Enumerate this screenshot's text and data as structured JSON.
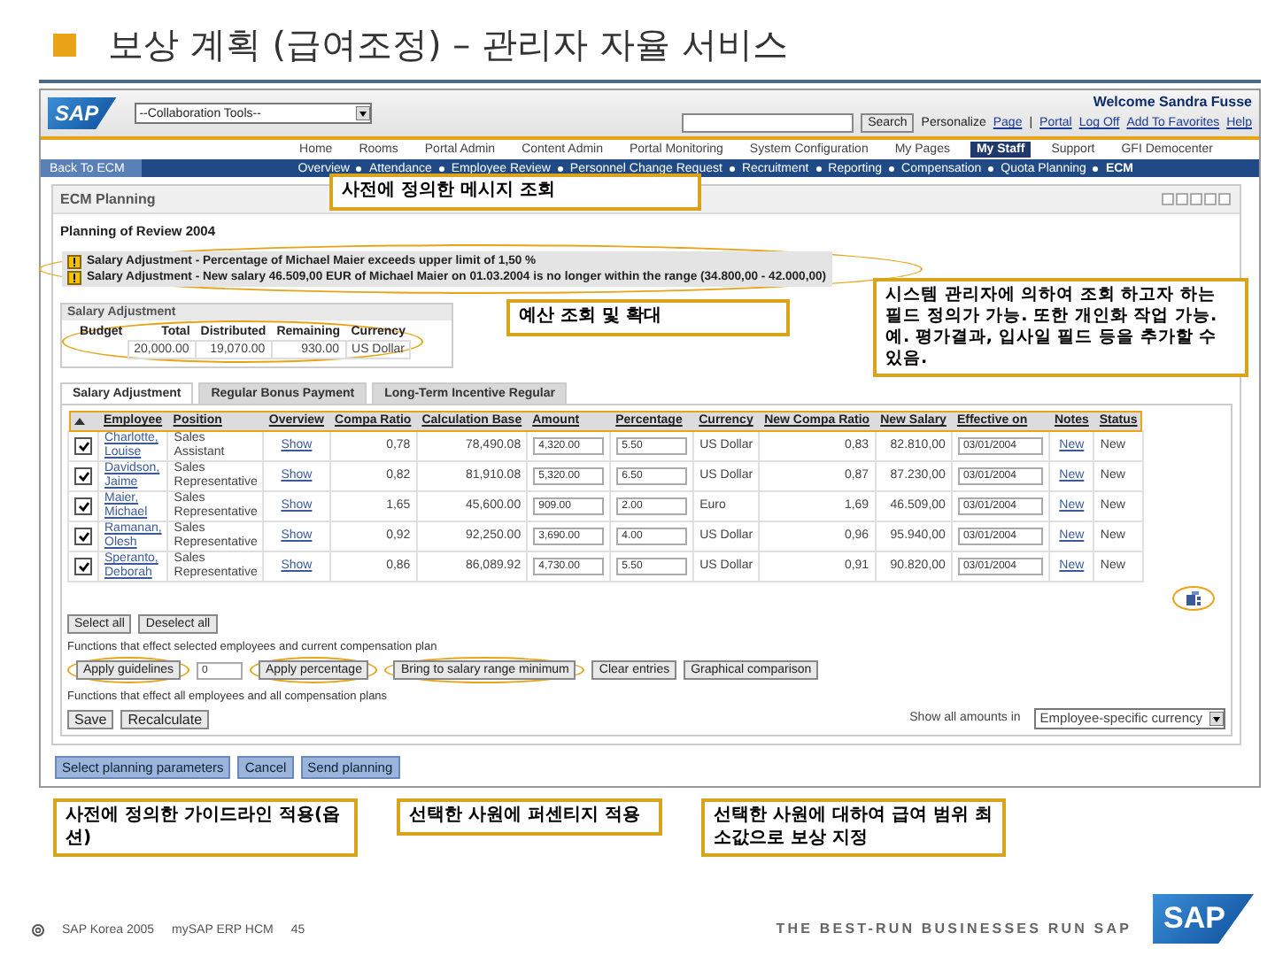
{
  "slide": {
    "title": "보상 계획 (급여조정) – 관리자 자율 서비스"
  },
  "portal": {
    "logo": "SAP",
    "tools_dropdown": "--Collaboration Tools--",
    "welcome": "Welcome Sandra Fusse",
    "search_button": "Search",
    "header_links": [
      {
        "label": "Personalize",
        "kind": "text"
      },
      {
        "label": "Page",
        "kind": "link"
      },
      {
        "label": "|",
        "kind": "text"
      },
      {
        "label": "Portal",
        "kind": "link"
      },
      {
        "label": "Log Off",
        "kind": "link"
      },
      {
        "label": "Add To Favorites",
        "kind": "link"
      },
      {
        "label": "Help",
        "kind": "link"
      }
    ],
    "top_nav": [
      {
        "label": "Home",
        "selected": false
      },
      {
        "label": "Rooms",
        "selected": false
      },
      {
        "label": "Portal Admin",
        "selected": false
      },
      {
        "label": "Content Admin",
        "selected": false
      },
      {
        "label": "Portal Monitoring",
        "selected": false
      },
      {
        "label": "System Configuration",
        "selected": false
      },
      {
        "label": "My Pages",
        "selected": false
      },
      {
        "label": "My Staff",
        "selected": true
      },
      {
        "label": "Support",
        "selected": false
      },
      {
        "label": "GFI Democenter",
        "selected": false
      }
    ],
    "back_button": "Back To ECM",
    "sub_nav": [
      {
        "label": "Overview",
        "selected": false
      },
      {
        "label": "Attendance",
        "selected": false
      },
      {
        "label": "Employee Review",
        "selected": false
      },
      {
        "label": "Personnel Change Request",
        "selected": false
      },
      {
        "label": "Recruitment",
        "selected": false
      },
      {
        "label": "Reporting",
        "selected": false
      },
      {
        "label": "Compensation",
        "selected": false
      },
      {
        "label": "Quota Planning",
        "selected": false
      },
      {
        "label": "ECM",
        "selected": true
      }
    ]
  },
  "panel": {
    "title": "ECM Planning",
    "subtitle": "Planning of Review 2004",
    "messages_circled": true,
    "messages": [
      {
        "kind": "warning",
        "text": "Salary Adjustment - Percentage of Michael Maier exceeds upper limit of 1,50 %"
      },
      {
        "kind": "warning",
        "text": "Salary Adjustment - New salary 46.509,00 EUR of Michael Maier on 01.03.2004 is no longer within the range (34.800,00 - 42.000,00)"
      }
    ],
    "budget": {
      "title": "Salary Adjustment",
      "circled": true,
      "columns": [
        "Budget",
        "Total",
        "Distributed",
        "Remaining",
        "Currency"
      ],
      "values": [
        "20,000.00",
        "19,070.00",
        "930.00",
        "US Dollar"
      ]
    },
    "tabs": [
      {
        "label": "Salary Adjustment",
        "selected": true
      },
      {
        "label": "Regular Bonus Payment",
        "selected": false
      },
      {
        "label": "Long-Term Incentive Regular",
        "selected": false
      }
    ],
    "table": {
      "header_circled": true,
      "columns": [
        "Employee",
        "Position",
        "Overview",
        "Compa Ratio",
        "Calculation Base",
        "Amount",
        "Percentage",
        "Currency",
        "New Compa Ratio",
        "New Salary",
        "Effective on",
        "Notes",
        "Status"
      ],
      "rows": [
        {
          "checked": true,
          "employee": "Charlotte, Louise",
          "position": "Sales Assistant",
          "overview": "Show",
          "compa_ratio": "0,78",
          "calculation_base": "78,490.08",
          "amount": "4,320.00",
          "percentage": "5.50",
          "currency": "US Dollar",
          "new_compa_ratio": "0,83",
          "new_salary": "82.810,00",
          "effective_on": "03/01/2004",
          "notes": "New",
          "status": "New"
        },
        {
          "checked": true,
          "employee": "Davidson, Jaime",
          "position": "Sales Representative",
          "overview": "Show",
          "compa_ratio": "0,82",
          "calculation_base": "81,910.08",
          "amount": "5,320.00",
          "percentage": "6.50",
          "currency": "US Dollar",
          "new_compa_ratio": "0,87",
          "new_salary": "87.230,00",
          "effective_on": "03/01/2004",
          "notes": "New",
          "status": "New"
        },
        {
          "checked": true,
          "employee": "Maier, Michael",
          "position": "Sales Representative",
          "overview": "Show",
          "compa_ratio": "1,65",
          "calculation_base": "45,600.00",
          "amount": "909.00",
          "percentage": "2.00",
          "currency": "Euro",
          "new_compa_ratio": "1,69",
          "new_salary": "46.509,00",
          "effective_on": "03/01/2004",
          "notes": "New",
          "status": "New"
        },
        {
          "checked": true,
          "employee": "Ramanan, Olesh",
          "position": "Sales Representative",
          "overview": "Show",
          "compa_ratio": "0,92",
          "calculation_base": "92,250.00",
          "amount": "3,690.00",
          "percentage": "4.00",
          "currency": "US Dollar",
          "new_compa_ratio": "0,96",
          "new_salary": "95.940,00",
          "effective_on": "03/01/2004",
          "notes": "New",
          "status": "New"
        },
        {
          "checked": true,
          "employee": "Speranto, Deborah",
          "position": "Sales Representative",
          "overview": "Show",
          "compa_ratio": "0,86",
          "calculation_base": "86,089.92",
          "amount": "4,730.00",
          "percentage": "5.50",
          "currency": "US Dollar",
          "new_compa_ratio": "0,91",
          "new_salary": "90.820,00",
          "effective_on": "03/01/2004",
          "notes": "New",
          "status": "New"
        }
      ]
    },
    "settings_circled": true,
    "selection_buttons": [
      "Select all",
      "Deselect all"
    ],
    "selected_functions": {
      "label": "Functions that effect selected employees and current compensation plan",
      "controls": [
        {
          "kind": "button",
          "label": "Apply guidelines",
          "circled": true
        },
        {
          "kind": "input",
          "value": "0"
        },
        {
          "kind": "button",
          "label": "Apply percentage",
          "circled": true
        },
        {
          "kind": "button",
          "label": "Bring to salary range minimum",
          "circled": true
        },
        {
          "kind": "button",
          "label": "Clear entries",
          "circled": false
        },
        {
          "kind": "button",
          "label": "Graphical comparison",
          "circled": false
        }
      ]
    },
    "all_functions": {
      "label": "Functions that effect all employees and all compensation plans",
      "buttons": [
        "Save",
        "Recalculate"
      ]
    },
    "currency_select": {
      "label": "Show all amounts in",
      "value": "Employee-specific currency"
    }
  },
  "footer_buttons": [
    "Select planning parameters",
    "Cancel",
    "Send planning"
  ],
  "callouts": {
    "messages": "사전에 정의한 메시지 조회",
    "budget": "예산 조회 및 확대",
    "columns": "시스템 관리자에 의하여 조회 하고자 하는 필드 정의가 가능. 또한 개인화 작업 가능. 예. 평가결과, 입사일 필드 등을 추가할 수 있음.",
    "bottom": [
      "사전에 정의한 가이드라인 적용(옵션)",
      "선택한 사원에 퍼센티지 적용",
      "선택한 사원에 대하여 급여 범위 최소값으로 보상 지정"
    ]
  },
  "footer": {
    "copyright": "SAP Korea 2005",
    "product": "mySAP ERP HCM",
    "page": "45",
    "tagline": "THE BEST-RUN BUSINESSES RUN SAP",
    "logo": "SAP"
  }
}
